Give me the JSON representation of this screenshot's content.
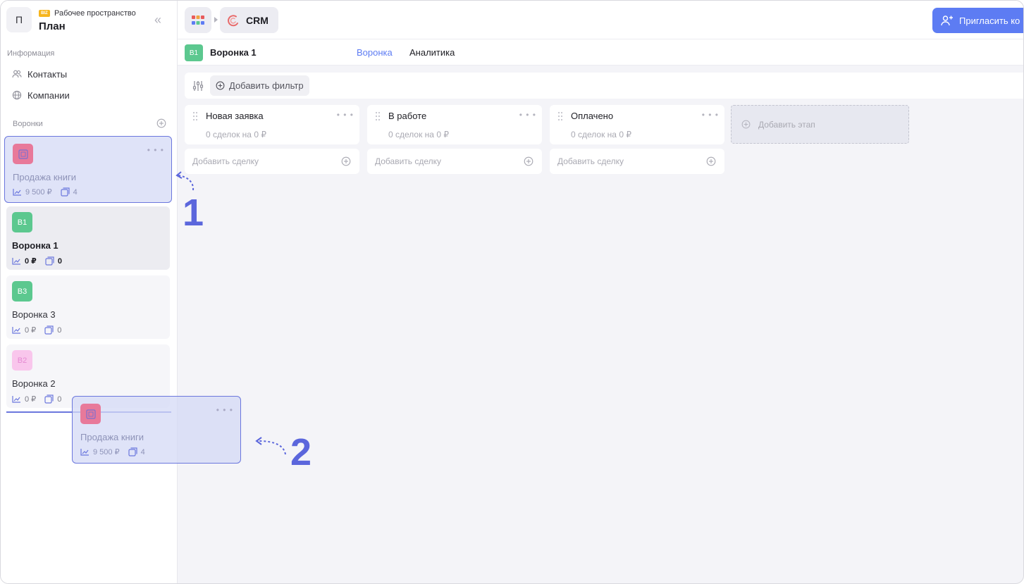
{
  "workspace": {
    "avatar_letter": "П",
    "badge": "BIZ",
    "subtitle": "Рабочее пространство",
    "name": "План"
  },
  "sidebar": {
    "info_label": "Информация",
    "nav": [
      {
        "label": "Контакты",
        "icon": "contacts-icon"
      },
      {
        "label": "Компании",
        "icon": "globe-icon"
      }
    ],
    "funnels_label": "Воронки",
    "funnels": [
      {
        "badge": "",
        "badge_color": "#e8799a",
        "name": "Продажа книги",
        "amount": "9 500 ₽",
        "count": "4",
        "state": "dragging-source"
      },
      {
        "badge": "В1",
        "badge_color": "#5cc88f",
        "name": "Воронка 1",
        "amount": "0 ₽",
        "count": "0",
        "state": "active"
      },
      {
        "badge": "В3",
        "badge_color": "#5cc88f",
        "name": "Воронка 3",
        "amount": "0 ₽",
        "count": "0",
        "state": "normal"
      },
      {
        "badge": "В2",
        "badge_color": "#f9c6ec",
        "badge_text_color": "#e58ad2",
        "name": "Воронка 2",
        "amount": "0 ₽",
        "count": "0",
        "state": "normal"
      }
    ],
    "ghost": {
      "name": "Продажа книги",
      "amount": "9 500 ₽",
      "count": "4"
    }
  },
  "topbar": {
    "crm_label": "CRM",
    "invite_label": "Пригласить ко"
  },
  "subheader": {
    "badge": "В1",
    "title": "Воронка 1",
    "tabs": [
      {
        "label": "Воронка",
        "active": true
      },
      {
        "label": "Аналитика",
        "active": false
      }
    ]
  },
  "filter": {
    "add_filter_label": "Добавить фильтр"
  },
  "board": {
    "stages": [
      {
        "title": "Новая заявка",
        "summary": "0 сделок на 0 ₽",
        "add_deal": "Добавить сделку"
      },
      {
        "title": "В работе",
        "summary": "0 сделок на 0 ₽",
        "add_deal": "Добавить сделку"
      },
      {
        "title": "Оплачено",
        "summary": "0 сделок на 0 ₽",
        "add_deal": "Добавить сделку"
      }
    ],
    "add_stage_label": "Добавить этап"
  },
  "annotations": {
    "step1": "1",
    "step2": "2"
  },
  "colors": {
    "accent": "#5d7cf3",
    "annotation": "#5b66dc",
    "green_badge": "#5cc88f",
    "pink_badge": "#e8799a"
  }
}
